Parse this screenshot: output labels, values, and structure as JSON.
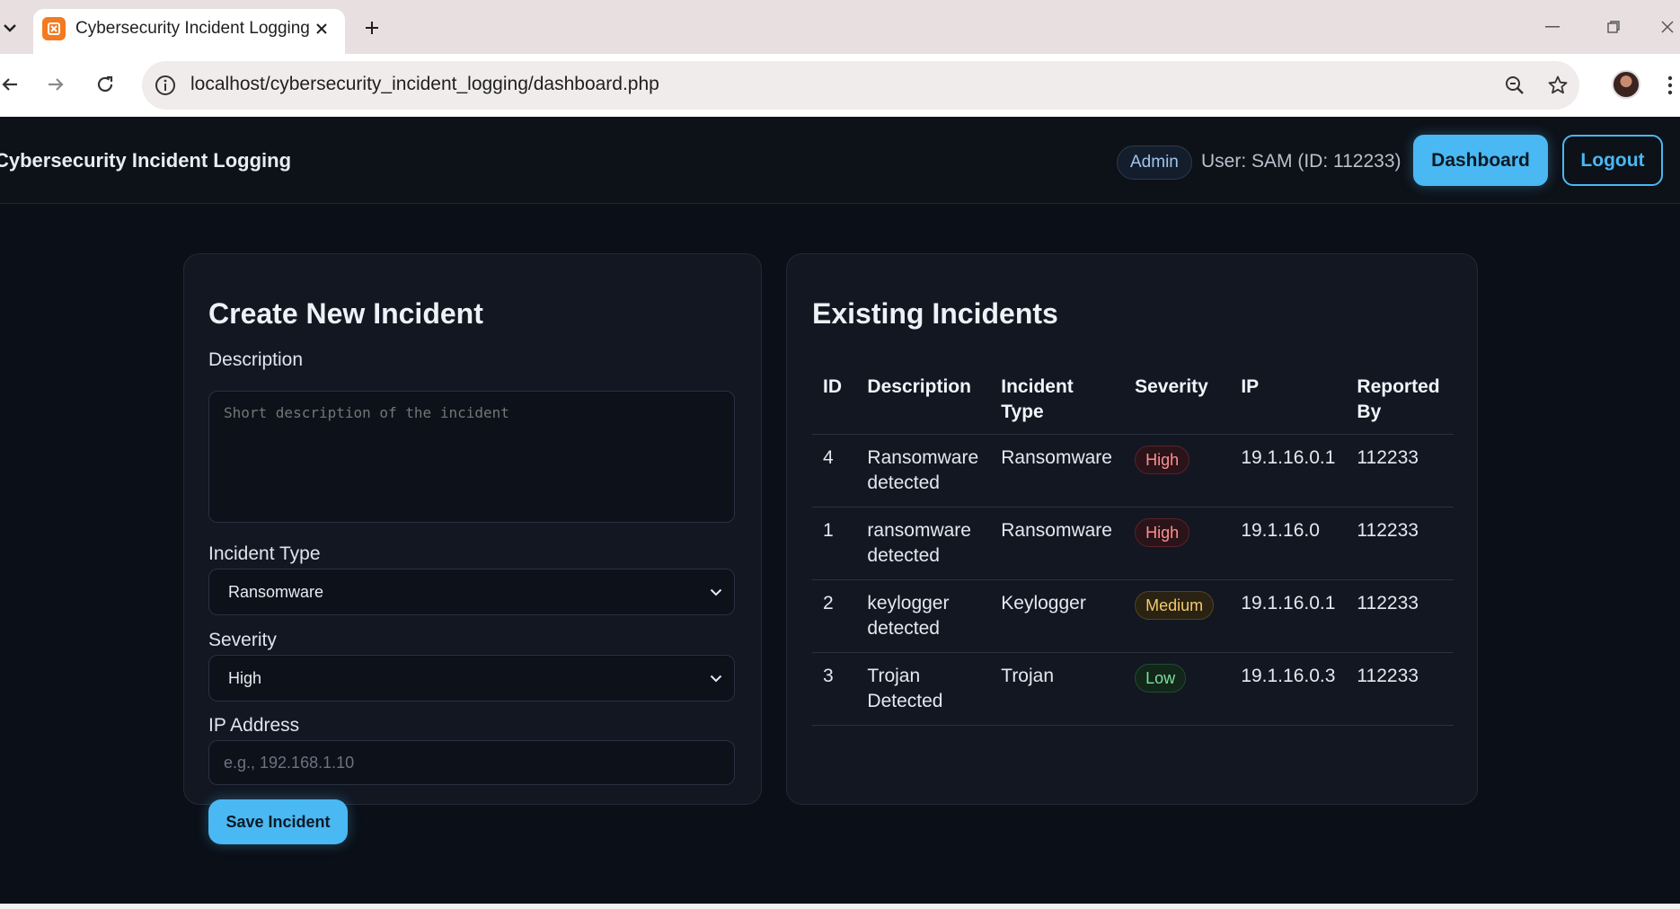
{
  "browser": {
    "tab_title": "Cybersecurity Incident Logging",
    "url": "localhost/cybersecurity_incident_logging/dashboard.php",
    "icons": [
      "tab-list-icon",
      "favicon-icon",
      "close-icon",
      "plus-icon",
      "minimize-icon",
      "restore-icon",
      "window-close-icon",
      "back-icon",
      "forward-icon",
      "reload-icon",
      "info-icon",
      "zoom-icon",
      "star-icon",
      "avatar",
      "more-icon"
    ]
  },
  "header": {
    "brand": "Cybersecurity Incident Logging",
    "role": "Admin",
    "user": "User: SAM (ID: 112233)",
    "dashboard_label": "Dashboard",
    "logout_label": "Logout"
  },
  "create": {
    "title": "Create New Incident",
    "description_label": "Description",
    "description_placeholder": "Short description of the incident",
    "type_label": "Incident Type",
    "type_value": "Ransomware",
    "severity_label": "Severity",
    "severity_value": "High",
    "ip_label": "IP Address",
    "ip_placeholder": "e.g., 192.168.1.10",
    "save_label": "Save Incident"
  },
  "list": {
    "title": "Existing Incidents",
    "columns": [
      "ID",
      "Description",
      "Incident Type",
      "Severity",
      "IP",
      "Reported By"
    ],
    "rows": [
      {
        "id": "4",
        "description": "Ransomware detected",
        "type": "Ransomware",
        "severity": "High",
        "ip": "19.1.16.0.1",
        "reported_by": "112233"
      },
      {
        "id": "1",
        "description": "ransomware detected",
        "type": "Ransomware",
        "severity": "High",
        "ip": "19.1.16.0",
        "reported_by": "112233"
      },
      {
        "id": "2",
        "description": "keylogger detected",
        "type": "Keylogger",
        "severity": "Medium",
        "ip": "19.1.16.0.1",
        "reported_by": "112233"
      },
      {
        "id": "3",
        "description": "Trojan Detected",
        "type": "Trojan",
        "severity": "Low",
        "ip": "19.1.16.0.3",
        "reported_by": "112233"
      }
    ]
  },
  "colors": {
    "accent": "#4ab8f2",
    "background": "#0b0f17",
    "card": "#121722",
    "severity_high": "#ff8f8f",
    "severity_medium": "#f3c96a",
    "severity_low": "#7fe09a"
  }
}
